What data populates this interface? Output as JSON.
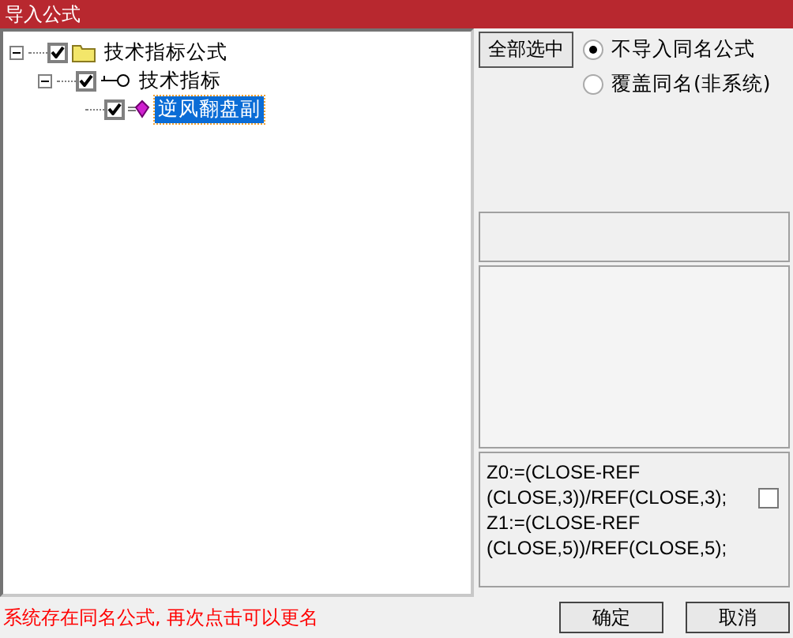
{
  "window": {
    "title": "导入公式"
  },
  "tree": [
    {
      "label": "技术指标公式",
      "kind": "folder",
      "checked": true,
      "expanded": true,
      "selected": false,
      "children": [
        {
          "label": "技术指标",
          "kind": "key",
          "checked": true,
          "expanded": true,
          "selected": false,
          "children": [
            {
              "label": "逆风翻盘副",
              "kind": "formula",
              "checked": true,
              "selected": true
            }
          ]
        }
      ]
    }
  ],
  "select_all_button": "全部选中",
  "options": [
    {
      "label": "不导入同名公式",
      "selected": true
    },
    {
      "label": "覆盖同名(非系统)",
      "selected": false
    }
  ],
  "code_lines": [
    "Z0:=(CLOSE-REF",
    "(CLOSE,3))/REF(CLOSE,3);",
    "Z1:=(CLOSE-REF",
    "(CLOSE,5))/REF(CLOSE,5);"
  ],
  "code_checkbox": {
    "checked": false
  },
  "status_message": "系统存在同名公式, 再次点击可以更名",
  "buttons": [
    "确定",
    "取消"
  ]
}
